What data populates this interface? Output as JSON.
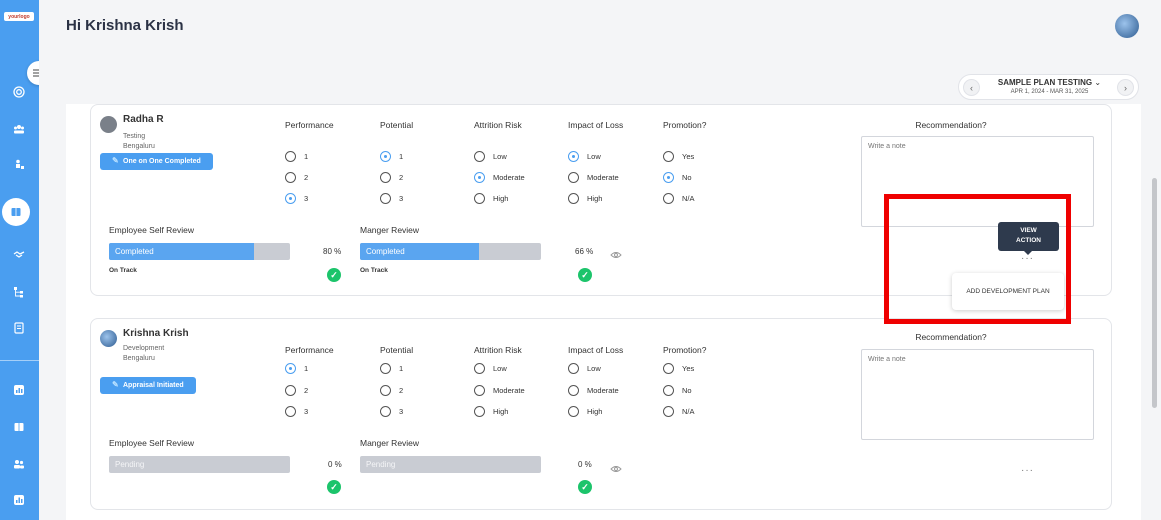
{
  "sidebar": {
    "logo": "yourlogo",
    "icons": [
      "target-icon",
      "team-icon",
      "person-tree-icon",
      "book-icon",
      "handshake-icon",
      "org-chart-icon",
      "document-icon",
      "chart-icon",
      "book-alt-icon",
      "users-icon",
      "report-icon"
    ]
  },
  "header": {
    "greeting": "Hi Krishna Krish"
  },
  "plan": {
    "title": "SAMPLE PLAN TESTING",
    "range": "APR 1, 2024 - MAR 31, 2025",
    "prev": "‹",
    "next": "›"
  },
  "columns": {
    "performance": "Performance",
    "potential": "Potential",
    "attrition": "Attrition Risk",
    "impact": "Impact of Loss",
    "promotion": "Promotion?",
    "recommendation": "Recommendation?"
  },
  "options": {
    "levels": [
      "1",
      "2",
      "3"
    ],
    "risk": [
      "Low",
      "Moderate",
      "High"
    ],
    "promotion": [
      "Yes",
      "No",
      "N/A"
    ]
  },
  "review_labels": {
    "self": "Employee Self Review",
    "manager": "Manger Review"
  },
  "note_placeholder": "Write a note",
  "employees": [
    {
      "name": "Radha R",
      "department": "Testing",
      "location": "Bengaluru",
      "status": "One on One Completed",
      "self_review": {
        "label": "Completed",
        "percent_text": "80 %",
        "progress": 0.8,
        "track": "On Track"
      },
      "manager_review": {
        "label": "Completed",
        "percent_text": "66 %",
        "progress": 0.66,
        "track": "On Track"
      }
    },
    {
      "name": "Krishna Krish",
      "department": "Development",
      "location": "Bengaluru",
      "status": "Appraisal Initiated",
      "self_review": {
        "label": "Pending",
        "percent_text": "0 %",
        "progress": 0,
        "track": ""
      },
      "manager_review": {
        "label": "Pending",
        "percent_text": "0 %",
        "progress": 0,
        "track": ""
      }
    }
  ],
  "action_menu": {
    "tooltip_line1": "VIEW",
    "tooltip_line2": "ACTION",
    "item": "ADD DEVELOPMENT PLAN",
    "dots": "···"
  },
  "colors": {
    "accent": "#4a9ef0",
    "check": "#1cc46b",
    "highlight": "#ef0000"
  }
}
